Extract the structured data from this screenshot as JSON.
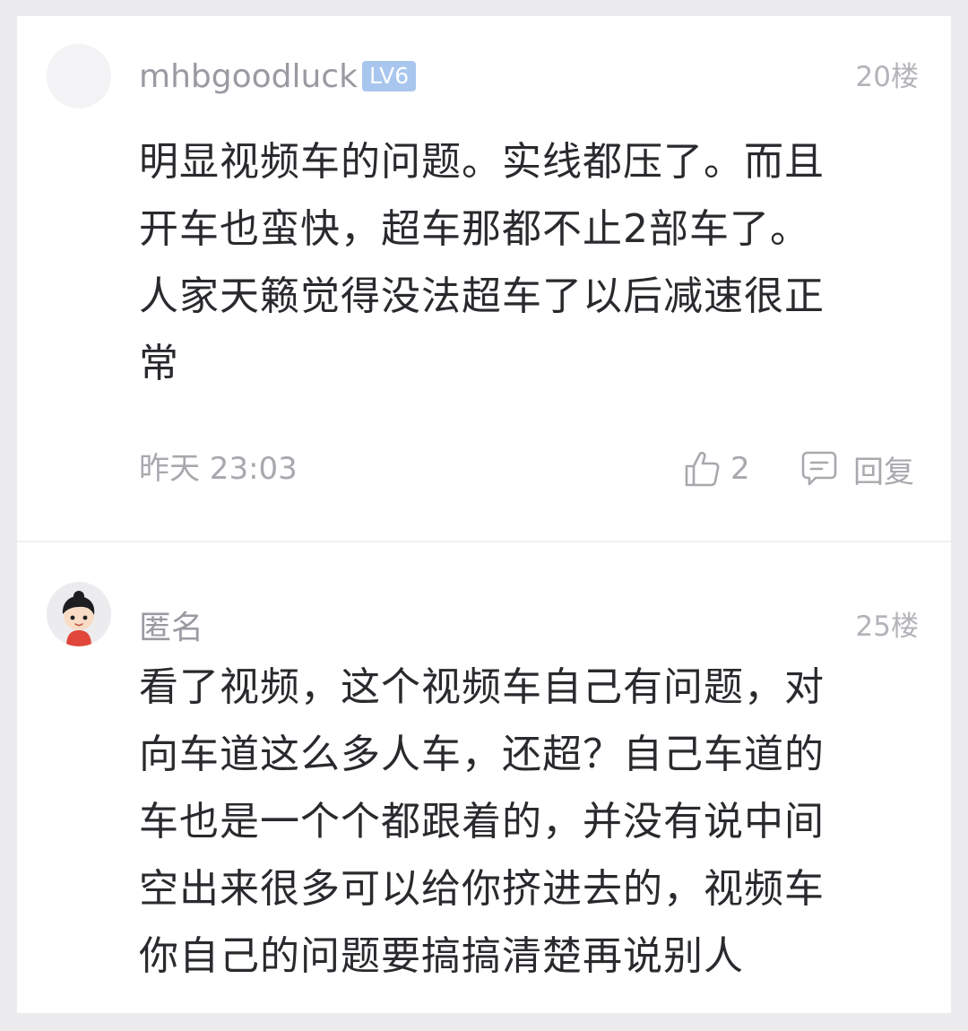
{
  "comments": [
    {
      "username": "mhbgoodluck",
      "level": "LV6",
      "floor": "20楼",
      "lines": [
        "明显视频车的问题。实线都压了。而且",
        "开车也蛮快，超车那都不止2部车了。",
        "人家天籁觉得没法超车了以后减速很正",
        "常"
      ],
      "time": "昨天 23:03",
      "likes": "2",
      "reply_label": "回复"
    },
    {
      "username": "匿名",
      "floor": "25楼",
      "lines": [
        "看了视频，这个视频车自己有问题，对",
        "向车道这么多人车，还超？自己车道的",
        "车也是一个个都跟着的，并没有说中间",
        "空出来很多可以给你挤进去的，视频车",
        "你自己的问题要搞搞清楚再说别人"
      ]
    }
  ],
  "colors": {
    "background": "#ececee",
    "card": "#ffffff",
    "badge": "#a9c6ee",
    "text": "#2a2a2e",
    "muted": "#a8a8ae"
  },
  "icons": {
    "like": "thumbs-up-icon",
    "reply": "comment-bubble-icon"
  }
}
